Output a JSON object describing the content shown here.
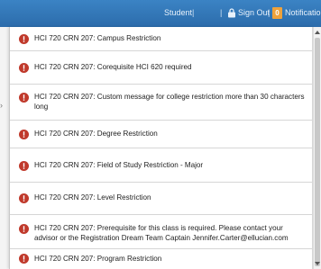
{
  "header": {
    "user_label": "Student",
    "sign_out_label": "Sign Out",
    "notification_count": "0",
    "notifications_label": "Notifications"
  },
  "colors": {
    "header_bg": "#2f72b2",
    "badge": "#f0a23a",
    "error_icon": "#c0392b"
  },
  "notifications": [
    {
      "icon": "error-icon",
      "text": "HCI 720 CRN 207: Campus Restriction"
    },
    {
      "icon": "error-icon",
      "text": "HCI 720 CRN 207: Corequisite HCI 620 required"
    },
    {
      "icon": "error-icon",
      "text": "HCI 720 CRN 207: Custom message for college restriction more than 30 characters long"
    },
    {
      "icon": "error-icon",
      "text": "HCI 720 CRN 207: Degree Restriction"
    },
    {
      "icon": "error-icon",
      "text": "HCI 720 CRN 207: Field of Study Restriction - Major"
    },
    {
      "icon": "error-icon",
      "text": "HCI 720 CRN 207: Level Restriction"
    },
    {
      "icon": "error-icon",
      "text": "HCI 720 CRN 207: Prerequisite for this class is required. Please contact your advisor or the Registration Dream Team Captain Jennifer.Carter@ellucian.com"
    },
    {
      "icon": "error-icon",
      "text": "HCI 720 CRN 207: Program Restriction"
    }
  ]
}
